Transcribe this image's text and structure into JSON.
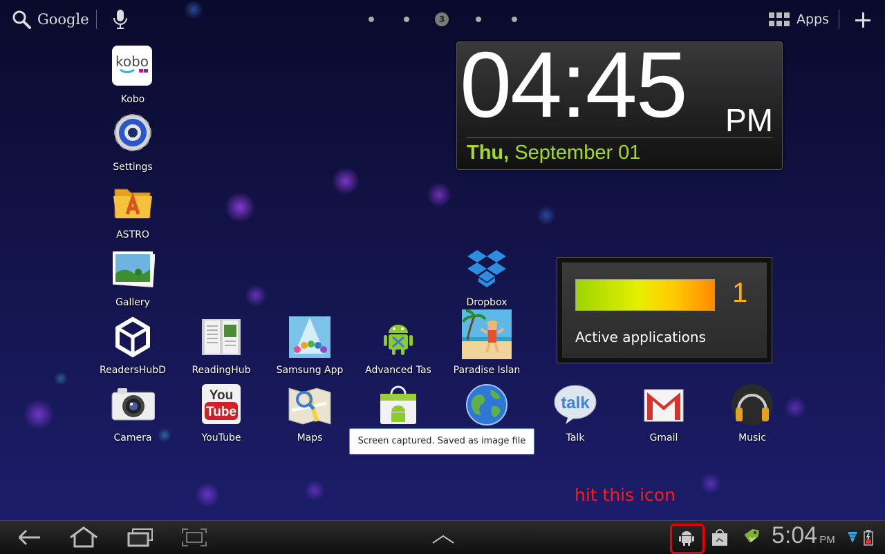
{
  "topbar": {
    "search_label": "Google",
    "pager": {
      "current": "3",
      "total_dots": 5
    },
    "apps_label": "Apps"
  },
  "home_icons": [
    {
      "name": "kobo",
      "label": "Kobo"
    },
    {
      "name": "settings",
      "label": "Settings"
    },
    {
      "name": "astro",
      "label": "ASTRO"
    },
    {
      "name": "gallery",
      "label": "Gallery"
    },
    {
      "name": "dropbox",
      "label": "Dropbox"
    },
    {
      "name": "readershubd",
      "label": "ReadersHubD"
    },
    {
      "name": "readinghub",
      "label": "ReadingHub"
    },
    {
      "name": "samsung-apps",
      "label": "Samsung App"
    },
    {
      "name": "advanced-task",
      "label": "Advanced Tas"
    },
    {
      "name": "paradise-island",
      "label": "Paradise Islan"
    },
    {
      "name": "camera",
      "label": "Camera"
    },
    {
      "name": "youtube",
      "label": "YouTube"
    },
    {
      "name": "maps",
      "label": "Maps"
    },
    {
      "name": "market",
      "label": ""
    },
    {
      "name": "browser",
      "label": ""
    },
    {
      "name": "talk",
      "label": "Talk"
    },
    {
      "name": "gmail",
      "label": "Gmail"
    },
    {
      "name": "music",
      "label": "Music"
    }
  ],
  "clock_widget": {
    "time": "04:45",
    "ampm": "PM",
    "day": "Thu,",
    "date": "September 01"
  },
  "task_widget": {
    "count": "1",
    "label": "Active applications",
    "level": 1.0
  },
  "toast": {
    "text": "Screen captured. Saved as image file"
  },
  "annotation": {
    "text": "hit this icon"
  },
  "system_bar": {
    "time": "5:04",
    "ampm": "PM",
    "icons": [
      "back-icon",
      "home-icon",
      "recent-apps-icon",
      "screenshot-icon",
      "menu-up-icon",
      "android-notification-icon",
      "market-bag-icon",
      "price-tag-icon",
      "wifi-icon",
      "battery-icon"
    ]
  },
  "colors": {
    "date_green": "#a6d925",
    "count_orange": "#ffb400",
    "annotation_red": "#ff1a1a",
    "highlight_red": "#e00000"
  }
}
